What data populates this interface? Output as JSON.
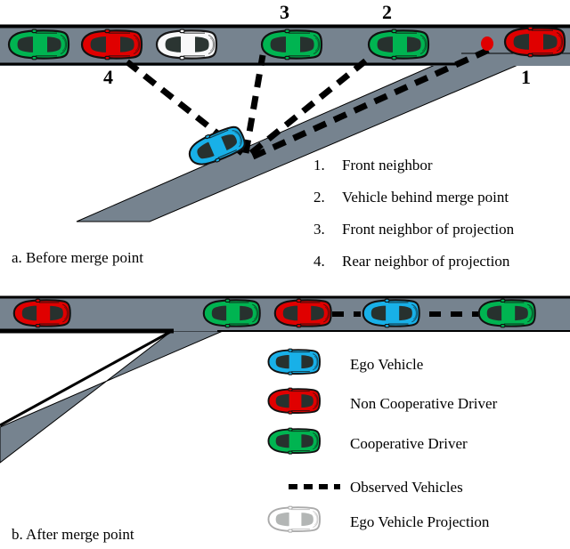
{
  "figure": {
    "panels": [
      {
        "id": "a",
        "caption": "a. Before merge point"
      },
      {
        "id": "b",
        "caption": "b. After merge point"
      }
    ]
  },
  "panel_a": {
    "numbered_markers": [
      {
        "id": "4",
        "label": "4"
      },
      {
        "id": "3",
        "label": "3"
      },
      {
        "id": "2",
        "label": "2"
      },
      {
        "id": "1",
        "label": "1"
      }
    ],
    "legend_list": [
      {
        "num": "1.",
        "text": "Front neighbor"
      },
      {
        "num": "2.",
        "text": "Vehicle behind merge point"
      },
      {
        "num": "3.",
        "text": "Front neighbor of projection"
      },
      {
        "num": "4.",
        "text": "Rear neighbor of projection"
      }
    ],
    "main_road_vehicles": [
      {
        "type": "cooperative",
        "color": "#00b451",
        "marker": ""
      },
      {
        "type": "non-cooperative",
        "color": "#e00000",
        "marker": "4"
      },
      {
        "type": "ego-projection",
        "color": "#ffffff",
        "marker": ""
      },
      {
        "type": "cooperative",
        "color": "#00b451",
        "marker": "3"
      },
      {
        "type": "cooperative",
        "color": "#00b451",
        "marker": "2"
      },
      {
        "type": "non-cooperative",
        "color": "#e00000",
        "marker": "1"
      }
    ],
    "ramp_vehicle": {
      "type": "ego",
      "color": "#18b0e8"
    },
    "merge_point_dot_color": "#e00000"
  },
  "panel_b": {
    "main_road_vehicles": [
      {
        "type": "non-cooperative",
        "color": "#e00000"
      },
      {
        "type": "cooperative",
        "color": "#00b451"
      },
      {
        "type": "non-cooperative",
        "color": "#e00000"
      },
      {
        "type": "ego",
        "color": "#18b0e8"
      },
      {
        "type": "cooperative",
        "color": "#00b451"
      }
    ]
  },
  "legend": {
    "items": [
      {
        "icon": "car-blue",
        "color": "#18b0e8",
        "label": "Ego Vehicle"
      },
      {
        "icon": "car-red",
        "color": "#e00000",
        "label": "Non Cooperative Driver"
      },
      {
        "icon": "car-green",
        "color": "#00b451",
        "label": "Cooperative Driver"
      },
      {
        "icon": "dashed-line",
        "color": "#000000",
        "label": "Observed Vehicles"
      },
      {
        "icon": "car-white",
        "color": "#ffffff",
        "label": "Ego Vehicle Projection"
      }
    ]
  },
  "colors": {
    "road": "#76838f",
    "road_edge": "#000000",
    "ego": "#18b0e8",
    "cooperative": "#00b451",
    "non_cooperative": "#e00000",
    "projection": "#ffffff",
    "window": "#27312e",
    "dash": "#000000",
    "background": "#ffffff"
  }
}
